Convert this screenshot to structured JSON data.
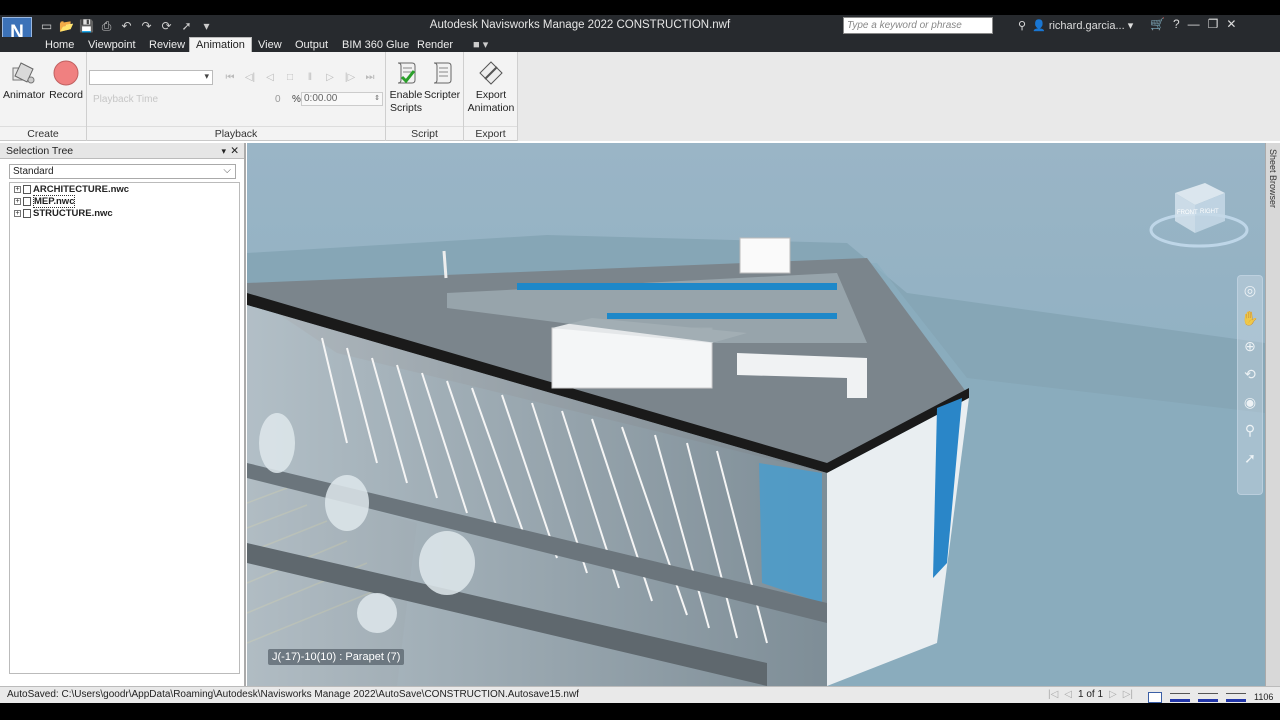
{
  "app": {
    "logo_letter": "N",
    "title": "Autodesk Navisworks Manage 2022    CONSTRUCTION.nwf",
    "search_placeholder": "Type a keyword or phrase",
    "user_name": "richard.garcia..."
  },
  "tabs": [
    {
      "label": "Home"
    },
    {
      "label": "Viewpoint"
    },
    {
      "label": "Review"
    },
    {
      "label": "Animation",
      "active": true
    },
    {
      "label": "View"
    },
    {
      "label": "Output"
    },
    {
      "label": "BIM 360 Glue"
    },
    {
      "label": "Render"
    }
  ],
  "ribbon": {
    "create": {
      "label": "Create",
      "animator": "Animator",
      "record": "Record"
    },
    "playback": {
      "label": "Playback",
      "playback_time": "Playback Time",
      "zero": "0",
      "percent": "%",
      "time_value": "0:00.00"
    },
    "script": {
      "label": "Script",
      "enable_scripts_1": "Enable",
      "enable_scripts_2": "Scripts",
      "scripter": "Scripter"
    },
    "export": {
      "label": "Export",
      "export_animation_1": "Export",
      "export_animation_2": "Animation"
    }
  },
  "selection_tree": {
    "title": "Selection Tree",
    "mode": "Standard",
    "items": [
      "ARCHITECTURE.nwc",
      "MEP.nwc",
      "STRUCTURE.nwc"
    ]
  },
  "viewport": {
    "tooltip": "J(-17)-10(10) : Parapet (7)",
    "viewcube_front": "FRONT",
    "viewcube_right": "RIGHT"
  },
  "sheet_browser": {
    "label": "Sheet Browser"
  },
  "status": {
    "autosave": "AutoSaved: C:\\Users\\goodr\\AppData\\Roaming\\Autodesk\\Navisworks Manage 2022\\AutoSave\\CONSTRUCTION.Autosave15.nwf",
    "pager": "1 of 1",
    "memory": "1106"
  },
  "colors": {
    "title_bar": "#272a2e",
    "record_button": "#f08080",
    "sky_top": "#8fb0c4",
    "glass": "#2a86c8"
  }
}
